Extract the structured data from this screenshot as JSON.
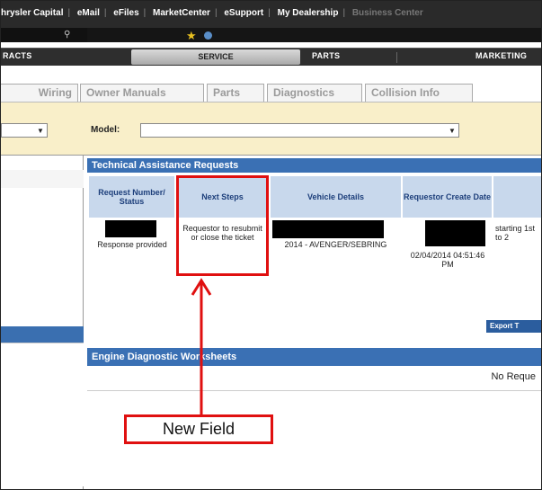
{
  "top_links": [
    "hrysler Capital",
    "eMail",
    "eFiles",
    "MarketCenter",
    "eSupport",
    "My Dealership",
    "Business Center"
  ],
  "main_nav": {
    "contracts": "RACTS",
    "service": "SERVICE",
    "parts": "PARTS",
    "marketing": "MARKETING"
  },
  "subtabs": [
    "Wiring",
    "Owner Manuals",
    "Parts",
    "Diagnostics",
    "Collision Info"
  ],
  "filter": {
    "model_label": "Model:",
    "model_value": ""
  },
  "tar": {
    "title": "Technical Assistance Requests",
    "columns": {
      "request": "Request Number/ Status",
      "next_steps": "Next Steps",
      "vehicle": "Vehicle Details",
      "create_date": "Requestor Create Date"
    },
    "row": {
      "status": "Response provided",
      "next_steps": "Requestor to resubmit or close the ticket",
      "vehicle": "2014 - AVENGER/SEBRING",
      "create_date": "02/04/2014 04:51:46 PM",
      "extra": "starting 1st to 2"
    },
    "export_label": "Export T"
  },
  "edw": {
    "title": "Engine Diagnostic Worksheets",
    "no_records": "No Reque"
  },
  "annotation": {
    "callout_text": "New Field",
    "color": "#e01010"
  },
  "colors": {
    "header_blue": "#3a70b4",
    "column_header_bg": "#c8d8ec",
    "filter_bg": "#f9efc9",
    "top_bar": "#2a2a2a"
  }
}
